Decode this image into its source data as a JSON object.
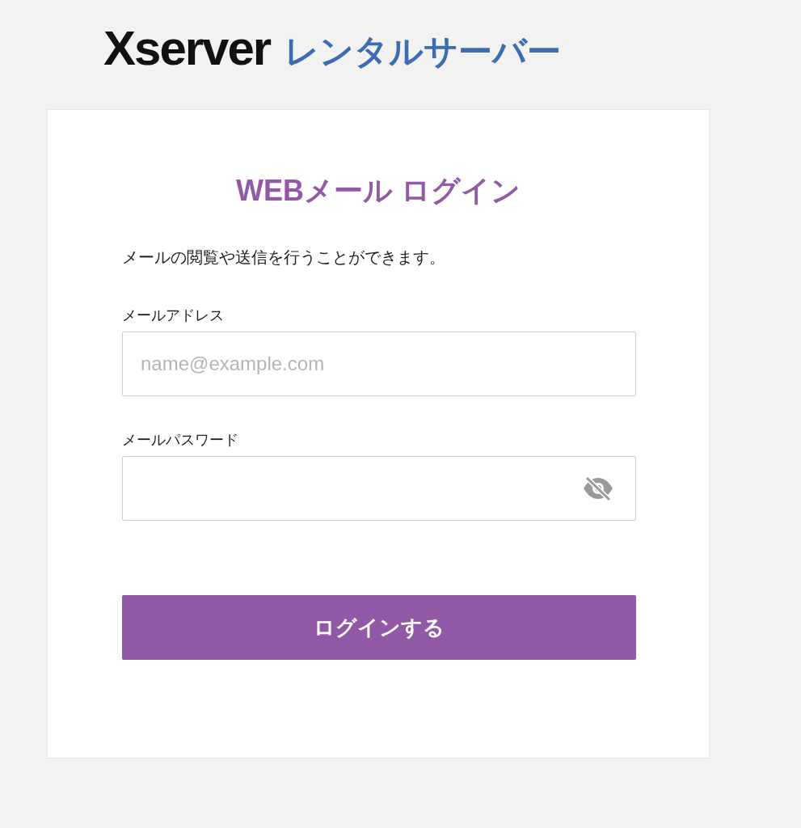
{
  "logo": {
    "brand": "Xserver",
    "product": "レンタルサーバー"
  },
  "card": {
    "title": "WEBメール ログイン",
    "description": "メールの閲覧や送信を行うことができます。",
    "fields": [
      {
        "kind": "text",
        "label": "メールアドレス",
        "placeholder": "name@example.com"
      },
      {
        "kind": "password",
        "label": "メールパスワード",
        "masked": true
      }
    ],
    "submit": "ログインする"
  }
}
